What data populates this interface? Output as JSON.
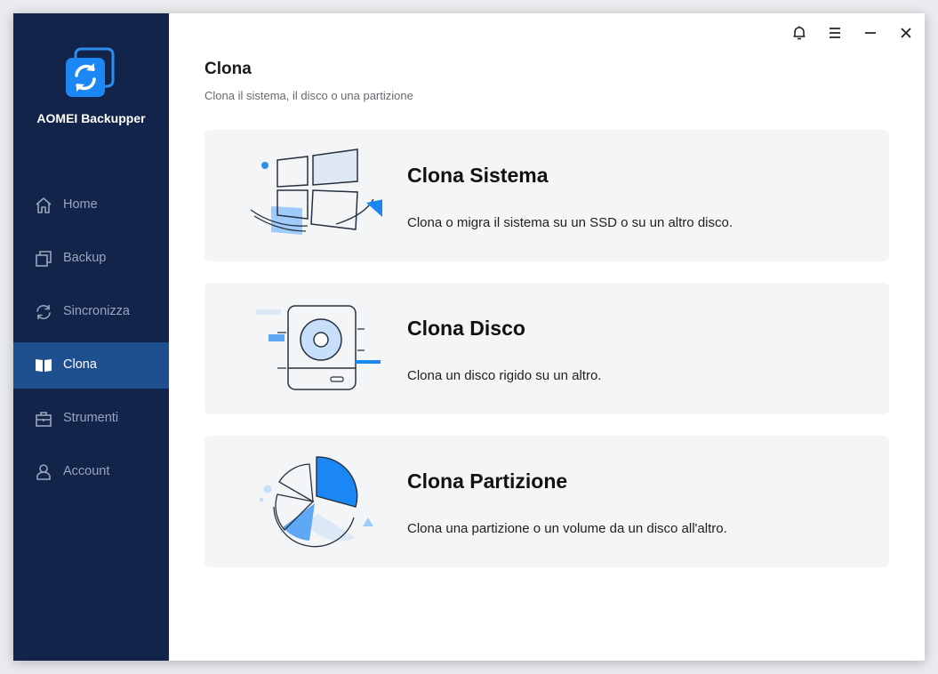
{
  "app": {
    "name": "AOMEI Backupper"
  },
  "sidebar": {
    "items": [
      {
        "label": "Home",
        "icon": "home-icon",
        "active": false
      },
      {
        "label": "Backup",
        "icon": "backup-icon",
        "active": false
      },
      {
        "label": "Sincronizza",
        "icon": "sync-icon",
        "active": false
      },
      {
        "label": "Clona",
        "icon": "clone-icon",
        "active": true
      },
      {
        "label": "Strumenti",
        "icon": "toolbox-icon",
        "active": false
      },
      {
        "label": "Account",
        "icon": "user-icon",
        "active": false
      }
    ]
  },
  "topbar": {
    "icons": [
      "bell-icon",
      "menu-icon",
      "minimize-icon",
      "close-icon"
    ]
  },
  "page": {
    "title": "Clona",
    "subtitle": "Clona il sistema, il disco o una partizione"
  },
  "cards": [
    {
      "title": "Clona Sistema",
      "description": "Clona o migra il sistema su un SSD o su un altro disco.",
      "icon": "windows-icon"
    },
    {
      "title": "Clona Disco",
      "description": "Clona un disco rigido su un altro.",
      "icon": "hard-disk-icon"
    },
    {
      "title": "Clona Partizione",
      "description": "Clona una partizione o un volume da un disco all'altro.",
      "icon": "pie-partition-icon"
    }
  ],
  "colors": {
    "sidebar_bg": "#13244a",
    "sidebar_active": "#1e4f8f",
    "accent": "#1a87f4",
    "card_bg": "#f4f5f7"
  }
}
